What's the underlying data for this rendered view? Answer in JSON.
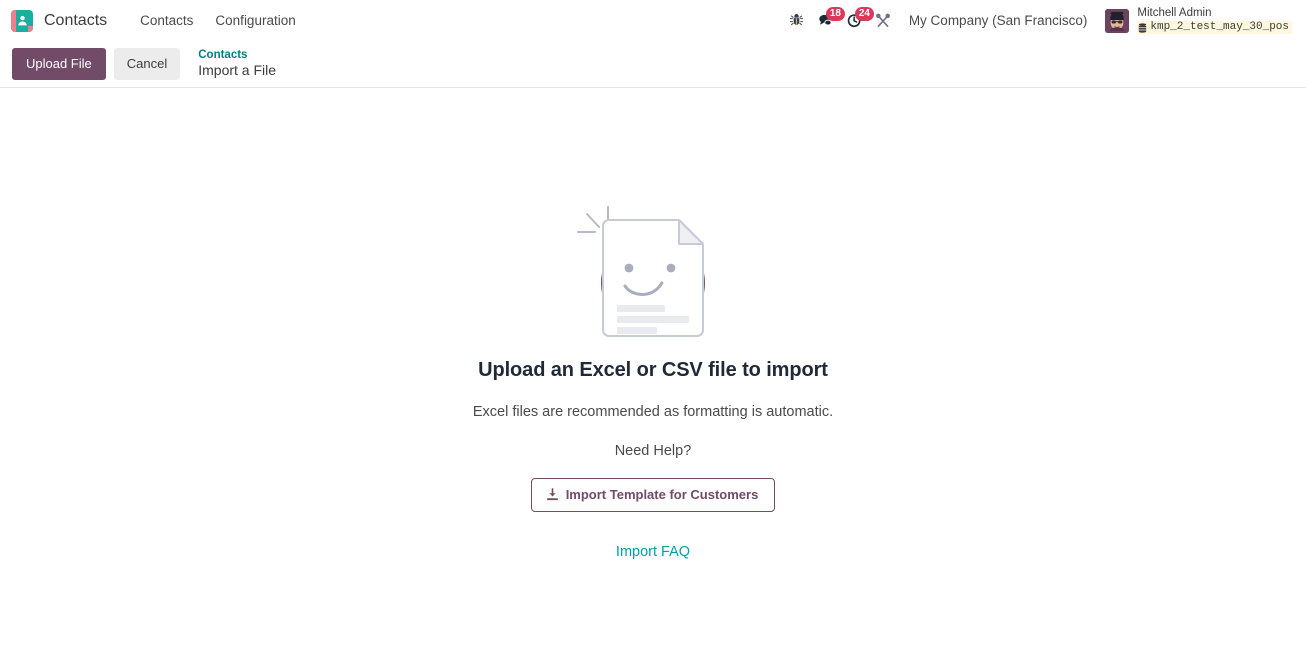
{
  "navbar": {
    "app_icon": "contacts-app-icon",
    "brand": "Contacts",
    "menu": [
      {
        "label": "Contacts"
      },
      {
        "label": "Configuration"
      }
    ],
    "systray": {
      "debug_icon": "bug-icon",
      "messages_icon": "chat-bubble-icon",
      "messages_count": "18",
      "activities_icon": "clock-icon",
      "activities_count": "24",
      "tools_icon": "wrench-screwdriver-icon",
      "company": "My Company (San Francisco)",
      "user_name": "Mitchell Admin",
      "database_icon": "database-icon",
      "database": "kmp_2_test_may_30_pos"
    },
    "badge_color": "#d9395a"
  },
  "control_panel": {
    "upload_label": "Upload File",
    "cancel_label": "Cancel",
    "breadcrumb_parent": "Contacts",
    "breadcrumb_current": "Import a File",
    "primary_color": "#714b67",
    "breadcrumb_link_color": "#017e84"
  },
  "main": {
    "illustration": "smiling-document-icon",
    "heading": "Upload an Excel or CSV file to import",
    "subtitle": "Excel files are recommended as formatting is automatic.",
    "need_help": "Need Help?",
    "template_button": "Import Template for Customers",
    "template_icon": "download-icon",
    "faq_link": "Import FAQ",
    "faq_color": "#00a0aa",
    "illustration_circle_color": "#714b67"
  }
}
